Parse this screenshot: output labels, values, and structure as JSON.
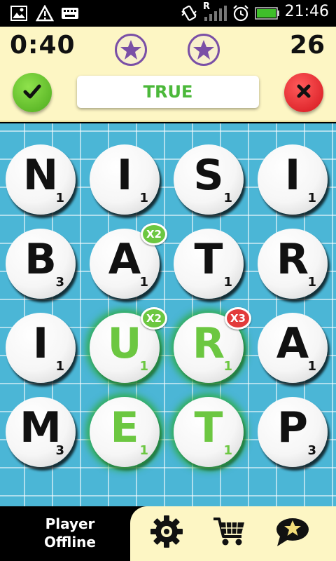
{
  "status_bar": {
    "time": "21:46",
    "network_label": "R",
    "icons": [
      "gallery-icon",
      "alert-icon",
      "keyboard-icon",
      "vibrate-icon",
      "signal-icon",
      "alarm-icon",
      "battery-icon"
    ]
  },
  "header": {
    "timer": "0:40",
    "score": "26",
    "stars_collected": 2,
    "result_text": "TRUE",
    "confirm_icon": "check-icon",
    "clear_icon": "close-icon"
  },
  "colors": {
    "header_bg": "#fdf6c4",
    "board_bg": "#4bb6d6",
    "selected_letter": "#6cc741",
    "result_text": "#4bb83a",
    "star_purple": "#7a4fa6",
    "multiplier_green": "#6cc741",
    "multiplier_red": "#e23b3b",
    "confirm_green": "#5bbf2a",
    "clear_red": "#e0242a"
  },
  "board": {
    "rows": [
      [
        {
          "letter": "N",
          "points": "1",
          "selected": false,
          "multiplier": ""
        },
        {
          "letter": "I",
          "points": "1",
          "selected": false,
          "multiplier": ""
        },
        {
          "letter": "S",
          "points": "1",
          "selected": false,
          "multiplier": ""
        },
        {
          "letter": "I",
          "points": "1",
          "selected": false,
          "multiplier": ""
        }
      ],
      [
        {
          "letter": "B",
          "points": "3",
          "selected": false,
          "multiplier": ""
        },
        {
          "letter": "A",
          "points": "1",
          "selected": false,
          "multiplier": "X2"
        },
        {
          "letter": "T",
          "points": "1",
          "selected": false,
          "multiplier": ""
        },
        {
          "letter": "R",
          "points": "1",
          "selected": false,
          "multiplier": ""
        }
      ],
      [
        {
          "letter": "I",
          "points": "1",
          "selected": false,
          "multiplier": ""
        },
        {
          "letter": "U",
          "points": "1",
          "selected": true,
          "multiplier": "X2"
        },
        {
          "letter": "R",
          "points": "1",
          "selected": true,
          "multiplier": "X3"
        },
        {
          "letter": "A",
          "points": "1",
          "selected": false,
          "multiplier": ""
        }
      ],
      [
        {
          "letter": "M",
          "points": "3",
          "selected": false,
          "multiplier": ""
        },
        {
          "letter": "E",
          "points": "1",
          "selected": true,
          "multiplier": ""
        },
        {
          "letter": "T",
          "points": "1",
          "selected": true,
          "multiplier": ""
        },
        {
          "letter": "P",
          "points": "3",
          "selected": false,
          "multiplier": ""
        }
      ]
    ]
  },
  "footer": {
    "player_line1": "Player",
    "player_line2": "Offline",
    "buttons": [
      {
        "name": "settings-button",
        "icon": "gear-icon"
      },
      {
        "name": "shop-button",
        "icon": "cart-icon"
      },
      {
        "name": "chat-button",
        "icon": "chat-star-icon"
      }
    ]
  }
}
